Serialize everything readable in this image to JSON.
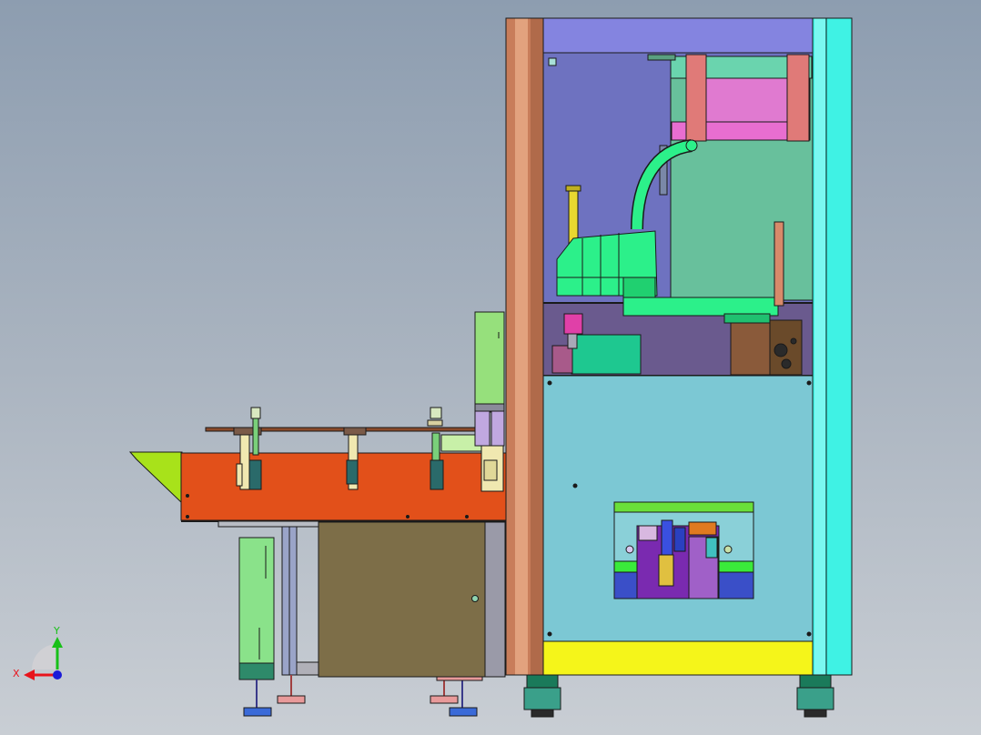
{
  "viewport": {
    "background_top": "#8d9db0",
    "background_bottom": "#c9ced4"
  },
  "triad": {
    "x_label": "X",
    "y_label": "Y",
    "x_color": "#e8141c",
    "y_color": "#18c018",
    "z_color": "#1a1ad8"
  },
  "palette": {
    "edge": "#1a1a1a",
    "cabinet_frame_copper": "#c87d5a",
    "cabinet_frame_cyan": "#3ff2e4",
    "cabinet_top_panel": "#8484e0",
    "cabinet_lower_panel": "#7cc8d4",
    "cabinet_base_yellow": "#f5f51a",
    "robot_green": "#2cf08a",
    "conveyor_orange": "#e2501a",
    "stand_olive": "#7d6e48",
    "chute_lime": "#a8e21a"
  }
}
